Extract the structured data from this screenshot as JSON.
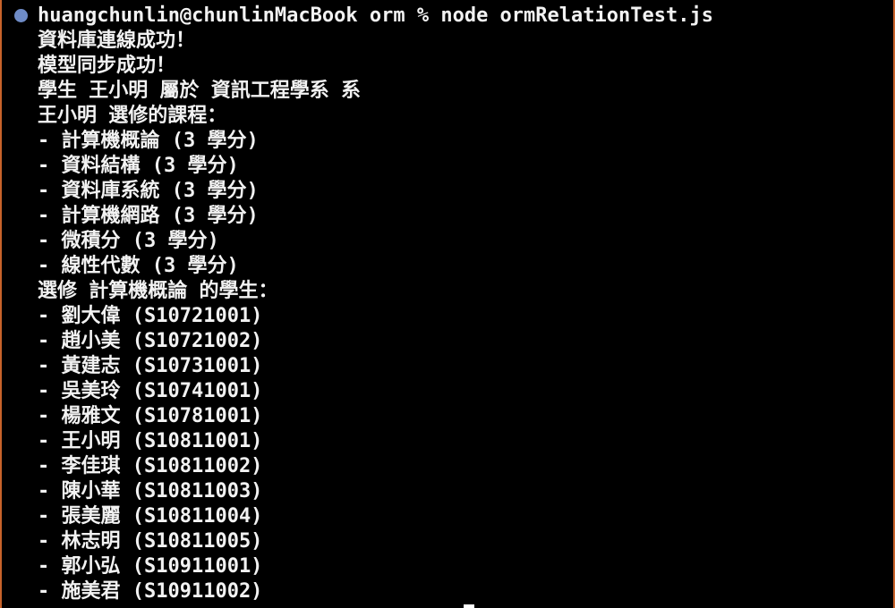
{
  "terminal": {
    "command_line": "huangchunlin@chunlinMacBook orm % node ormRelationTest.js",
    "output": [
      "資料庫連線成功！",
      "模型同步成功！",
      "學生 王小明 屬於 資訊工程學系 系",
      "王小明 選修的課程：",
      "- 計算機概論 (3 學分)",
      "- 資料結構 (3 學分)",
      "- 資料庫系統 (3 學分)",
      "- 計算機網路 (3 學分)",
      "- 微積分 (3 學分)",
      "- 線性代數 (3 學分)",
      "選修 計算機概論 的學生：",
      "- 劉大偉 (S10721001)",
      "- 趙小美 (S10721002)",
      "- 黃建志 (S10731001)",
      "- 吳美玲 (S10741001)",
      "- 楊雅文 (S10781001)",
      "- 王小明 (S10811001)",
      "- 李佳琪 (S10811002)",
      "- 陳小華 (S10811003)",
      "- 張美麗 (S10811004)",
      "- 林志明 (S10811005)",
      "- 郭小弘 (S10911001)",
      "- 施美君 (S10911002)"
    ],
    "colors": {
      "background": "#000000",
      "text": "#f2f2f2",
      "prompt_dot": "#6f8cc7",
      "window_border": "#c8632a"
    }
  }
}
